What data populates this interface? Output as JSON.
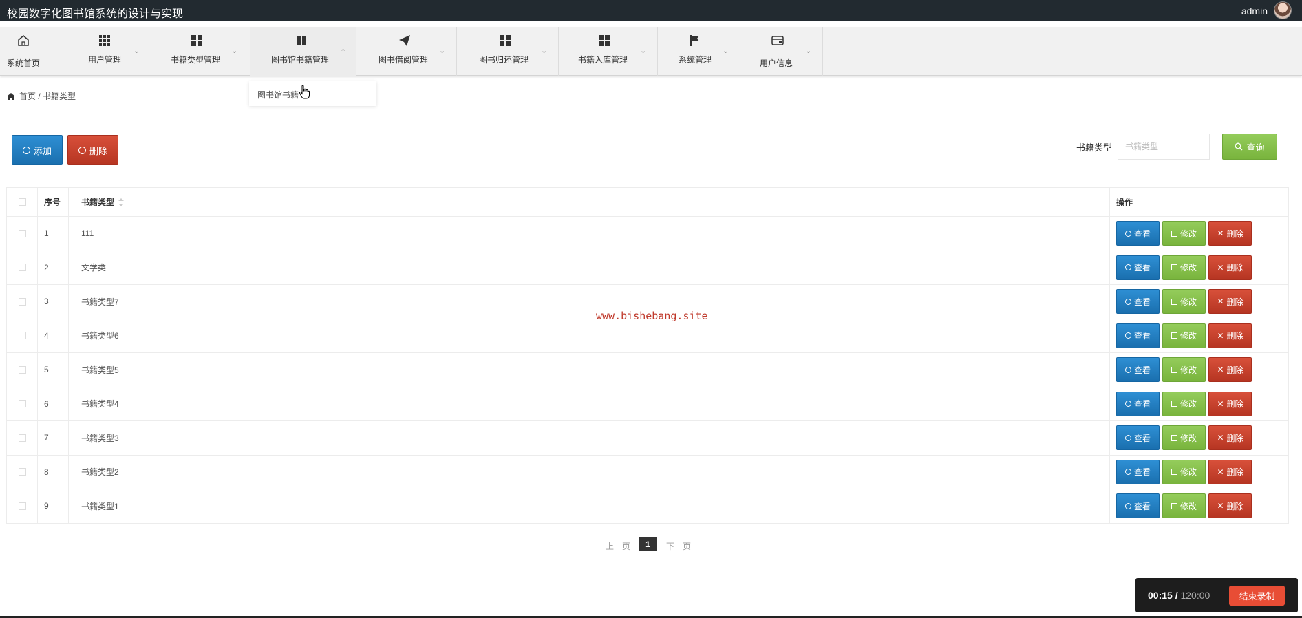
{
  "app": {
    "title": "校园数字化图书馆系统的设计与实现",
    "user": "admin"
  },
  "nav": {
    "items": [
      {
        "label": "系统首页",
        "icon": "home-icon"
      },
      {
        "label": "用户管理",
        "icon": "grid-icon"
      },
      {
        "label": "书籍类型管理",
        "icon": "squares-icon"
      },
      {
        "label": "图书馆书籍管理",
        "icon": "book-icon"
      },
      {
        "label": "图书借阅管理",
        "icon": "send-icon"
      },
      {
        "label": "图书归还管理",
        "icon": "squares-icon"
      },
      {
        "label": "书籍入库管理",
        "icon": "squares-icon"
      },
      {
        "label": "系统管理",
        "icon": "flag-icon"
      },
      {
        "label": "用户信息",
        "icon": "card-icon"
      }
    ],
    "dropdown": {
      "label": "图书馆书籍"
    }
  },
  "breadcrumb": {
    "home": "首页",
    "separator": "/",
    "current": "书籍类型"
  },
  "toolbar": {
    "add_label": "添加",
    "delete_label": "删除",
    "search_label": "书籍类型",
    "search_placeholder": "书籍类型",
    "query_label": "查询"
  },
  "table": {
    "headers": {
      "no": "序号",
      "type": "书籍类型",
      "ops": "操作"
    },
    "rows": [
      {
        "no": "1",
        "type": "111"
      },
      {
        "no": "2",
        "type": "文学类"
      },
      {
        "no": "3",
        "type": "书籍类型7"
      },
      {
        "no": "4",
        "type": "书籍类型6"
      },
      {
        "no": "5",
        "type": "书籍类型5"
      },
      {
        "no": "6",
        "type": "书籍类型4"
      },
      {
        "no": "7",
        "type": "书籍类型3"
      },
      {
        "no": "8",
        "type": "书籍类型2"
      },
      {
        "no": "9",
        "type": "书籍类型1"
      }
    ],
    "actions": {
      "view": "查看",
      "edit": "修改",
      "delete": "删除"
    }
  },
  "watermark": "www.bishebang.site",
  "pager": {
    "prev": "上一页",
    "current": "1",
    "next": "下一页"
  },
  "recorder": {
    "elapsed": "00:15",
    "separator": "/",
    "total": "120:00",
    "stop_label": "结束录制"
  },
  "colors": {
    "topbar": "#222a30",
    "primary": "#1a6fae",
    "success": "#79b43d",
    "danger": "#b63522"
  }
}
